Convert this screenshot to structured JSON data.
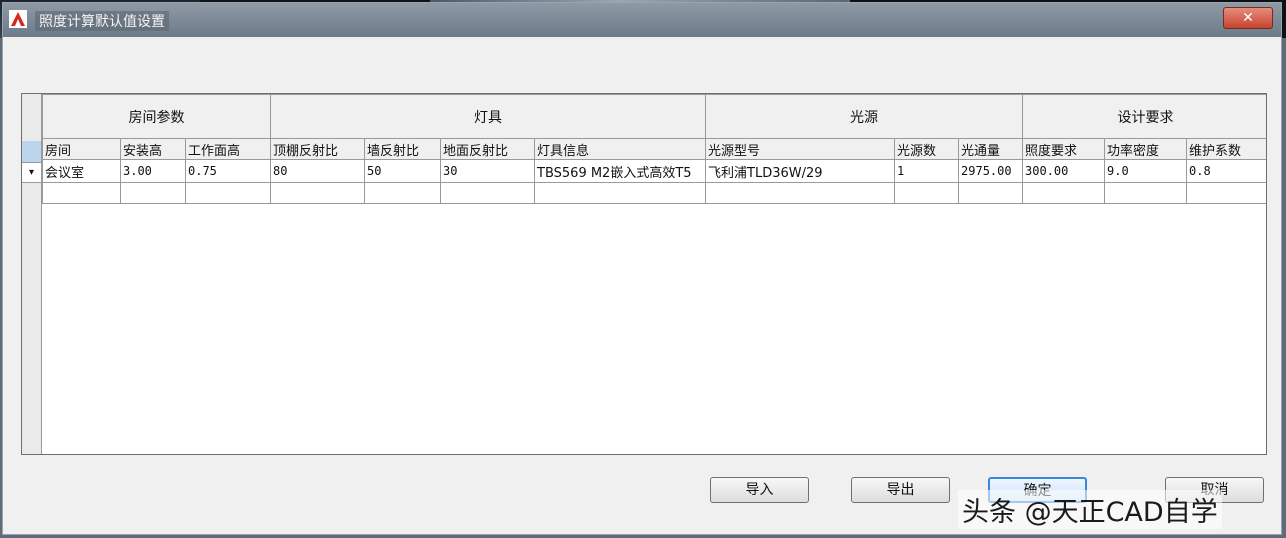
{
  "window": {
    "title": "照度计算默认值设置",
    "close_label": "✕"
  },
  "grid": {
    "groups": [
      "房间参数",
      "灯具",
      "光源",
      "设计要求"
    ],
    "columns": [
      "房间",
      "安装高",
      "工作面高",
      "顶棚反射比",
      "墙反射比",
      "地面反射比",
      "灯具信息",
      "光源型号",
      "光源数",
      "光通量",
      "照度要求",
      "功率密度",
      "维护系数"
    ],
    "rows": [
      [
        "会议室",
        "3.00",
        "0.75",
        "80",
        "50",
        "30",
        "TBS569 M2嵌入式高效T5",
        "飞利浦TLD36W/29",
        "1",
        "2975.00",
        "300.00",
        "9.0",
        "0.8"
      ]
    ],
    "new_row_marker": "▾"
  },
  "buttons": {
    "import": "导入",
    "export": "导出",
    "ok": "确定",
    "cancel": "取消"
  },
  "watermark": "头条 @天正CAD自学"
}
